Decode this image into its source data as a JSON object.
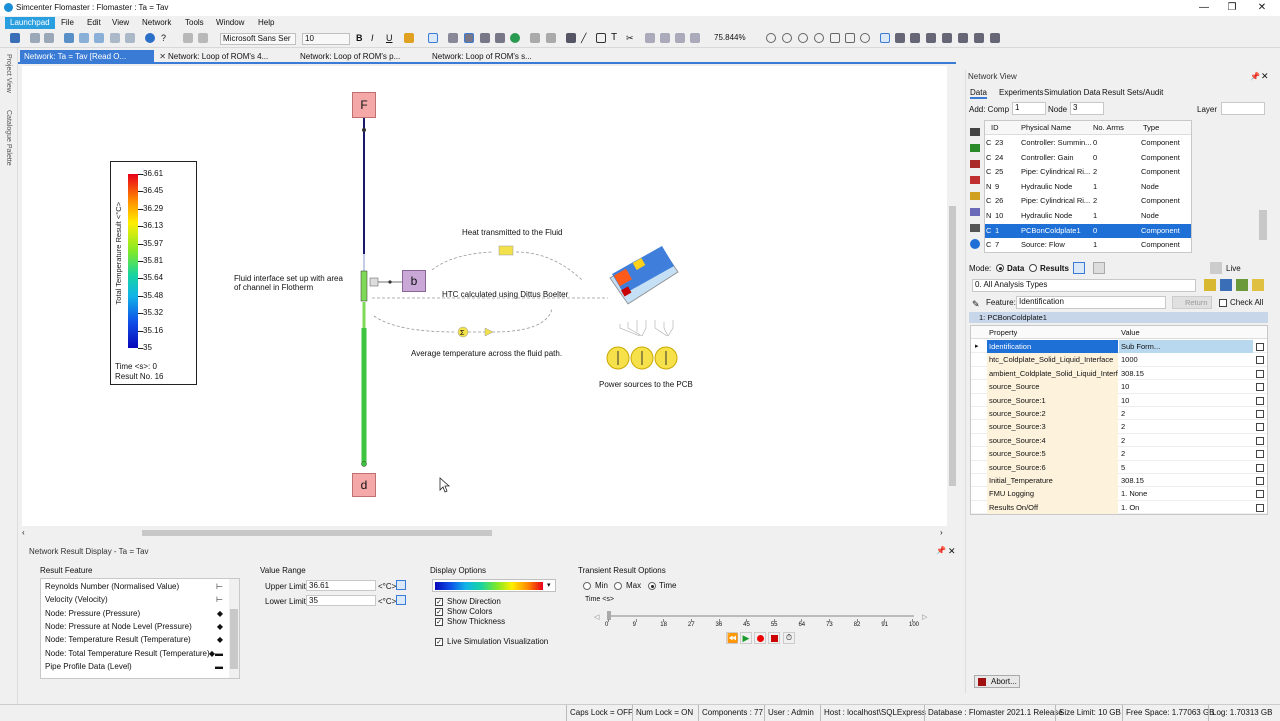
{
  "window": {
    "title": "Simcenter Flomaster : Flomaster : Ta = Tav",
    "minimize": "—",
    "restore": "❐",
    "close": "✕"
  },
  "menubar": {
    "items": [
      "Launchpad",
      "File",
      "Edit",
      "View",
      "Network",
      "Tools",
      "Window",
      "Help"
    ]
  },
  "toolbar": {
    "font": "Microsoft Sans Ser",
    "font_size": "10",
    "zoom": "75.844%"
  },
  "left_strip": {
    "project_view": "Project View",
    "catalogue_palette": "Catalogue Palette"
  },
  "tabs": [
    {
      "label": "Network: Ta = Tav [Read O..."
    },
    {
      "label": "Network: Loop of ROM's 4..."
    },
    {
      "label": "Network: Loop of ROM's p..."
    },
    {
      "label": "Network: Loop of ROM's s..."
    }
  ],
  "canvas": {
    "legend": {
      "axis_label": "Total Temperature Result <°C>",
      "values": [
        "36.61",
        "36.45",
        "36.29",
        "36.13",
        "35.97",
        "35.81",
        "35.64",
        "35.48",
        "35.32",
        "35.16",
        "35"
      ],
      "time": "Time <s>: 0",
      "result_no": "Result No. 16"
    },
    "node_top": "F",
    "node_bottom": "d",
    "node_mid": "b",
    "labels": {
      "heat": "Heat transmitted to the Fluid",
      "fluid_interface": "Fluid interface set up with area of channel in Flotherm",
      "htc": "HTC calculated using Dittus Boelter",
      "avg": "Average temperature across the fluid path.",
      "power": "Power sources to the PCB"
    }
  },
  "bottom": {
    "title": "Network Result Display - Ta = Tav",
    "result_feature": {
      "heading": "Result Feature",
      "items": [
        {
          "label": "Reynolds Number (Normalised Value)",
          "sym": "⊢"
        },
        {
          "label": "Velocity (Velocity)",
          "sym": "⊢"
        },
        {
          "label": "Node: Pressure (Pressure)",
          "sym": "◆"
        },
        {
          "label": "Node: Pressure at Node Level (Pressure)",
          "sym": "◆"
        },
        {
          "label": "Node: Temperature Result (Temperature)",
          "sym": "◆"
        },
        {
          "label": "Node: Total Temperature Result (Temperature)",
          "sym": "◆▬"
        },
        {
          "label": "Pipe Profile Data (Level)",
          "sym": "▬"
        }
      ]
    },
    "value_range": {
      "heading": "Value Range",
      "upper_label": "Upper Limit",
      "upper_value": "36.61",
      "lower_label": "Lower Limit",
      "lower_value": "35",
      "unit": "<°C>"
    },
    "display_options": {
      "heading": "Display Options",
      "show_direction": "Show Direction",
      "show_colors": "Show Colors",
      "show_thickness": "Show Thickness",
      "live_sim": "Live Simulation Visualization"
    },
    "transient": {
      "heading": "Transient Result Options",
      "min": "Min",
      "max": "Max",
      "time": "Time",
      "time_unit": "Time <s>",
      "ticks": [
        "0",
        "9",
        "18",
        "27",
        "36",
        "45",
        "55",
        "64",
        "73",
        "82",
        "91",
        "100"
      ]
    }
  },
  "network_view": {
    "title": "Network View",
    "tabs": [
      "Data",
      "Experiments",
      "Simulation Data",
      "Result Sets/Audit"
    ],
    "add_comp_label": "Add: Comp",
    "add_comp_value": "1",
    "node_label": "Node",
    "node_value": "3",
    "layer_label": "Layer",
    "columns": [
      "ID",
      "Physical Name",
      "No. Arms",
      "Type"
    ],
    "rows": [
      {
        "t": "C",
        "id": "23",
        "name": "Controller: Summin...",
        "arms": "0",
        "type": "Component"
      },
      {
        "t": "C",
        "id": "24",
        "name": "Controller: Gain",
        "arms": "0",
        "type": "Component"
      },
      {
        "t": "C",
        "id": "25",
        "name": "Pipe: Cylindrical Ri...",
        "arms": "2",
        "type": "Component"
      },
      {
        "t": "N",
        "id": "9",
        "name": "Hydraulic Node",
        "arms": "1",
        "type": "Node"
      },
      {
        "t": "C",
        "id": "26",
        "name": "Pipe: Cylindrical Ri...",
        "arms": "2",
        "type": "Component"
      },
      {
        "t": "N",
        "id": "10",
        "name": "Hydraulic Node",
        "arms": "1",
        "type": "Node"
      },
      {
        "t": "C",
        "id": "1",
        "name": "PCBonColdplate1",
        "arms": "0",
        "type": "Component"
      },
      {
        "t": "C",
        "id": "7",
        "name": "Source: Flow",
        "arms": "1",
        "type": "Component"
      }
    ]
  },
  "props": {
    "mode_label": "Mode:",
    "mode_data": "Data",
    "mode_results": "Results",
    "live": "Live",
    "analysis_type": "0. All Analysis Types",
    "feature_label": "Feature:",
    "feature_value": "Identification",
    "return_label": "Return",
    "check_all": "Check All",
    "group": "1: PCBonColdplate1",
    "col_property": "Property",
    "col_value": "Value",
    "rows": [
      {
        "p": "Identification",
        "v": "Sub Form..."
      },
      {
        "p": "htc_Coldplate_Solid_Liquid_Interface",
        "v": "1000"
      },
      {
        "p": "ambient_Coldplate_Solid_Liquid_Interf...",
        "v": "308.15"
      },
      {
        "p": "source_Source",
        "v": "10"
      },
      {
        "p": "source_Source:1",
        "v": "10"
      },
      {
        "p": "source_Source:2",
        "v": "2"
      },
      {
        "p": "source_Source:3",
        "v": "2"
      },
      {
        "p": "source_Source:4",
        "v": "2"
      },
      {
        "p": "source_Source:5",
        "v": "2"
      },
      {
        "p": "source_Source:6",
        "v": "5"
      },
      {
        "p": "Initial_Temperature",
        "v": "308.15"
      },
      {
        "p": "FMU Logging",
        "v": "1. None"
      },
      {
        "p": "Results On/Off",
        "v": "1. On"
      }
    ],
    "abort": "Abort..."
  },
  "status": {
    "caps": "Caps Lock = OFF",
    "num": "Num Lock = ON",
    "components": "Components : 77",
    "user": "User : Admin",
    "host": "Host : localhost\\SQLExpress",
    "database": "Database : Flomaster 2021.1 Release",
    "size_limit": "Size Limit: 10 GB",
    "free_space": "Free Space: 1.77063 GB",
    "log": "Log: 1.70313 GB"
  }
}
